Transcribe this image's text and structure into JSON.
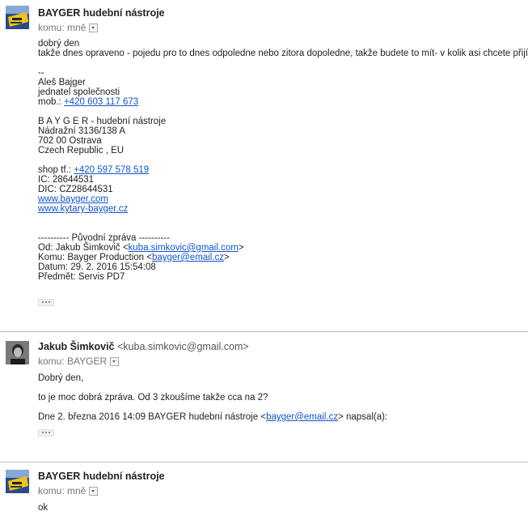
{
  "messages": [
    {
      "sender": "BAYGER hudební nástroje",
      "to_label": "komu: mně",
      "greeting": "dobrý den",
      "text": "takže dnes opraveno - pojedu pro to dnes odpoledne nebo zitora dopoledne, takže budete to mít- v kolik asi chcete přijít?",
      "sig_dash": "--",
      "sig_name": "Aleš Bajger",
      "sig_title": "jednatel společnosti",
      "sig_mob_label": "mob.: ",
      "sig_mob": "+420 603 117 673",
      "company": "B A Y G E R - hudební nástroje",
      "addr1": "Nádražní 3136/138 A",
      "addr2": "702 00 Ostrava",
      "addr3": "Czech Republic , EU",
      "shop_label": "shop tf.: ",
      "shop_phone": "+420 597 578 519",
      "ic": "IC: 28644531",
      "dic": "DIC: CZ28644531",
      "web1": "www.bayger.com",
      "web2": "www.kytary-bayger.cz",
      "fwd_header": "---------- Původní zpráva ----------",
      "fwd_from_label": "Od: Jakub Šimkovič <",
      "fwd_from_email": "kuba.simkovic@gmail.com",
      "fwd_from_end": ">",
      "fwd_to_label": "Komu: Bayger Production <",
      "fwd_to_email": "bayger@email.cz",
      "fwd_to_end": ">",
      "fwd_date": "Datum: 29. 2. 2016 15:54:08",
      "fwd_subject": "Předmět: Servis PD7"
    },
    {
      "sender": "Jakub Šimkovič",
      "sender_email": "<kuba.simkovic@gmail.com>",
      "to_label": "komu: BAYGER",
      "greeting": "Dobrý den,",
      "text": "to je moc dobrá zpráva. Od 3 zkoušíme takže cca na 2?",
      "quote_prefix": "Dne 2. března 2016 14:09 BAYGER hudební nástroje <",
      "quote_email": "bayger@email.cz",
      "quote_suffix": "> napsal(a):"
    },
    {
      "sender": "BAYGER hudební nástroje",
      "to_label": "komu: mně",
      "text": "ok"
    }
  ],
  "icons": {
    "dropdown": "chevron-down-icon",
    "show_trimmed": "ellipsis-icon"
  },
  "colors": {
    "link": "#1155cc",
    "divider": "#bbbbbb"
  }
}
